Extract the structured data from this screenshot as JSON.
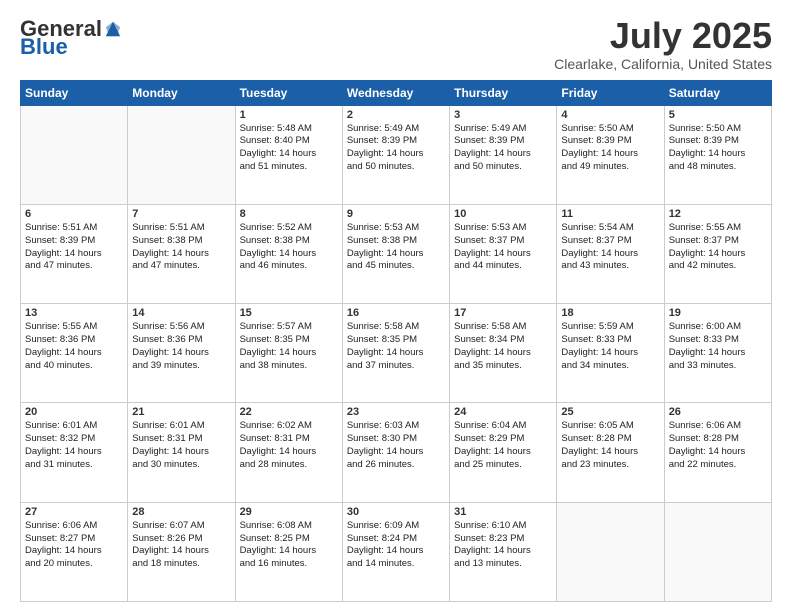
{
  "header": {
    "logo_general": "General",
    "logo_blue": "Blue",
    "month": "July 2025",
    "location": "Clearlake, California, United States"
  },
  "days_of_week": [
    "Sunday",
    "Monday",
    "Tuesday",
    "Wednesday",
    "Thursday",
    "Friday",
    "Saturday"
  ],
  "weeks": [
    [
      {
        "num": "",
        "text": "",
        "empty": true
      },
      {
        "num": "",
        "text": "",
        "empty": true
      },
      {
        "num": "1",
        "text": "Sunrise: 5:48 AM\nSunset: 8:40 PM\nDaylight: 14 hours\nand 51 minutes."
      },
      {
        "num": "2",
        "text": "Sunrise: 5:49 AM\nSunset: 8:39 PM\nDaylight: 14 hours\nand 50 minutes."
      },
      {
        "num": "3",
        "text": "Sunrise: 5:49 AM\nSunset: 8:39 PM\nDaylight: 14 hours\nand 50 minutes."
      },
      {
        "num": "4",
        "text": "Sunrise: 5:50 AM\nSunset: 8:39 PM\nDaylight: 14 hours\nand 49 minutes."
      },
      {
        "num": "5",
        "text": "Sunrise: 5:50 AM\nSunset: 8:39 PM\nDaylight: 14 hours\nand 48 minutes."
      }
    ],
    [
      {
        "num": "6",
        "text": "Sunrise: 5:51 AM\nSunset: 8:39 PM\nDaylight: 14 hours\nand 47 minutes."
      },
      {
        "num": "7",
        "text": "Sunrise: 5:51 AM\nSunset: 8:38 PM\nDaylight: 14 hours\nand 47 minutes."
      },
      {
        "num": "8",
        "text": "Sunrise: 5:52 AM\nSunset: 8:38 PM\nDaylight: 14 hours\nand 46 minutes."
      },
      {
        "num": "9",
        "text": "Sunrise: 5:53 AM\nSunset: 8:38 PM\nDaylight: 14 hours\nand 45 minutes."
      },
      {
        "num": "10",
        "text": "Sunrise: 5:53 AM\nSunset: 8:37 PM\nDaylight: 14 hours\nand 44 minutes."
      },
      {
        "num": "11",
        "text": "Sunrise: 5:54 AM\nSunset: 8:37 PM\nDaylight: 14 hours\nand 43 minutes."
      },
      {
        "num": "12",
        "text": "Sunrise: 5:55 AM\nSunset: 8:37 PM\nDaylight: 14 hours\nand 42 minutes."
      }
    ],
    [
      {
        "num": "13",
        "text": "Sunrise: 5:55 AM\nSunset: 8:36 PM\nDaylight: 14 hours\nand 40 minutes."
      },
      {
        "num": "14",
        "text": "Sunrise: 5:56 AM\nSunset: 8:36 PM\nDaylight: 14 hours\nand 39 minutes."
      },
      {
        "num": "15",
        "text": "Sunrise: 5:57 AM\nSunset: 8:35 PM\nDaylight: 14 hours\nand 38 minutes."
      },
      {
        "num": "16",
        "text": "Sunrise: 5:58 AM\nSunset: 8:35 PM\nDaylight: 14 hours\nand 37 minutes."
      },
      {
        "num": "17",
        "text": "Sunrise: 5:58 AM\nSunset: 8:34 PM\nDaylight: 14 hours\nand 35 minutes."
      },
      {
        "num": "18",
        "text": "Sunrise: 5:59 AM\nSunset: 8:33 PM\nDaylight: 14 hours\nand 34 minutes."
      },
      {
        "num": "19",
        "text": "Sunrise: 6:00 AM\nSunset: 8:33 PM\nDaylight: 14 hours\nand 33 minutes."
      }
    ],
    [
      {
        "num": "20",
        "text": "Sunrise: 6:01 AM\nSunset: 8:32 PM\nDaylight: 14 hours\nand 31 minutes."
      },
      {
        "num": "21",
        "text": "Sunrise: 6:01 AM\nSunset: 8:31 PM\nDaylight: 14 hours\nand 30 minutes."
      },
      {
        "num": "22",
        "text": "Sunrise: 6:02 AM\nSunset: 8:31 PM\nDaylight: 14 hours\nand 28 minutes."
      },
      {
        "num": "23",
        "text": "Sunrise: 6:03 AM\nSunset: 8:30 PM\nDaylight: 14 hours\nand 26 minutes."
      },
      {
        "num": "24",
        "text": "Sunrise: 6:04 AM\nSunset: 8:29 PM\nDaylight: 14 hours\nand 25 minutes."
      },
      {
        "num": "25",
        "text": "Sunrise: 6:05 AM\nSunset: 8:28 PM\nDaylight: 14 hours\nand 23 minutes."
      },
      {
        "num": "26",
        "text": "Sunrise: 6:06 AM\nSunset: 8:28 PM\nDaylight: 14 hours\nand 22 minutes."
      }
    ],
    [
      {
        "num": "27",
        "text": "Sunrise: 6:06 AM\nSunset: 8:27 PM\nDaylight: 14 hours\nand 20 minutes."
      },
      {
        "num": "28",
        "text": "Sunrise: 6:07 AM\nSunset: 8:26 PM\nDaylight: 14 hours\nand 18 minutes."
      },
      {
        "num": "29",
        "text": "Sunrise: 6:08 AM\nSunset: 8:25 PM\nDaylight: 14 hours\nand 16 minutes."
      },
      {
        "num": "30",
        "text": "Sunrise: 6:09 AM\nSunset: 8:24 PM\nDaylight: 14 hours\nand 14 minutes."
      },
      {
        "num": "31",
        "text": "Sunrise: 6:10 AM\nSunset: 8:23 PM\nDaylight: 14 hours\nand 13 minutes."
      },
      {
        "num": "",
        "text": "",
        "empty": true
      },
      {
        "num": "",
        "text": "",
        "empty": true
      }
    ]
  ]
}
